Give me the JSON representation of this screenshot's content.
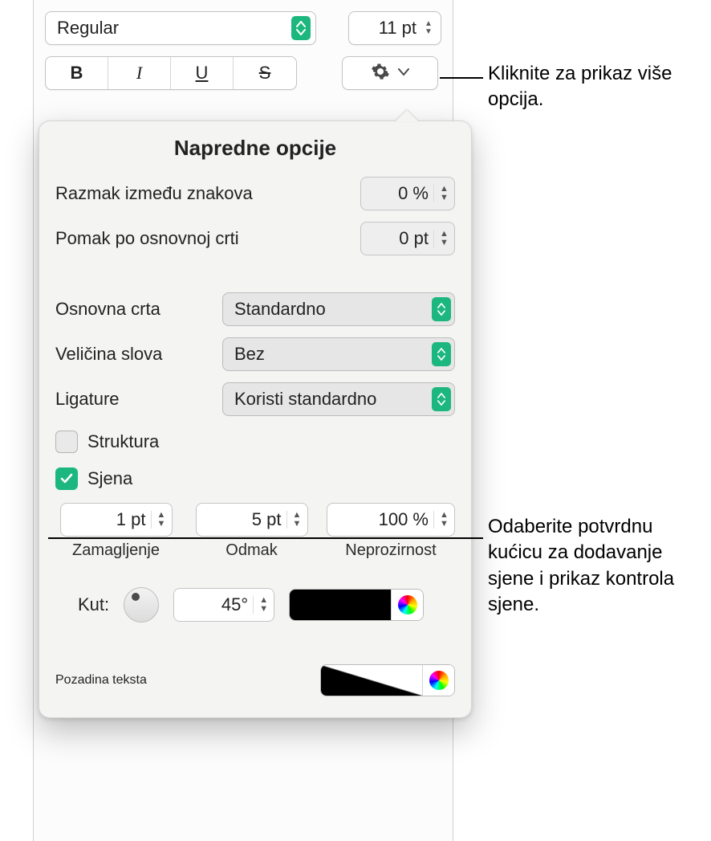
{
  "font": {
    "typeface": "Regular",
    "size": "11 pt"
  },
  "style_buttons": {
    "bold": "B",
    "italic": "I",
    "underline": "U",
    "strike": "S"
  },
  "popover": {
    "title": "Napredne opcije",
    "char_spacing_label": "Razmak između znakova",
    "char_spacing_value": "0 %",
    "baseline_shift_label": "Pomak po osnovnoj crti",
    "baseline_shift_value": "0 pt",
    "baseline_label": "Osnovna crta",
    "baseline_value": "Standardno",
    "caps_label": "Veličina slova",
    "caps_value": "Bez",
    "ligatures_label": "Ligature",
    "ligatures_value": "Koristi standardno",
    "outline_label": "Struktura",
    "shadow_label": "Sjena",
    "shadow": {
      "blur_value": "1 pt",
      "blur_caption": "Zamagljenje",
      "offset_value": "5 pt",
      "offset_caption": "Odmak",
      "opacity_value": "100 %",
      "opacity_caption": "Neprozirnost",
      "angle_label": "Kut:",
      "angle_value": "45°"
    },
    "textbg_label": "Pozadina teksta"
  },
  "callouts": {
    "gear": "Kliknite za prikaz više opcija.",
    "shadow": "Odaberite potvrdnu kućicu za dodavanje sjene i prikaz kontrola sjene."
  }
}
